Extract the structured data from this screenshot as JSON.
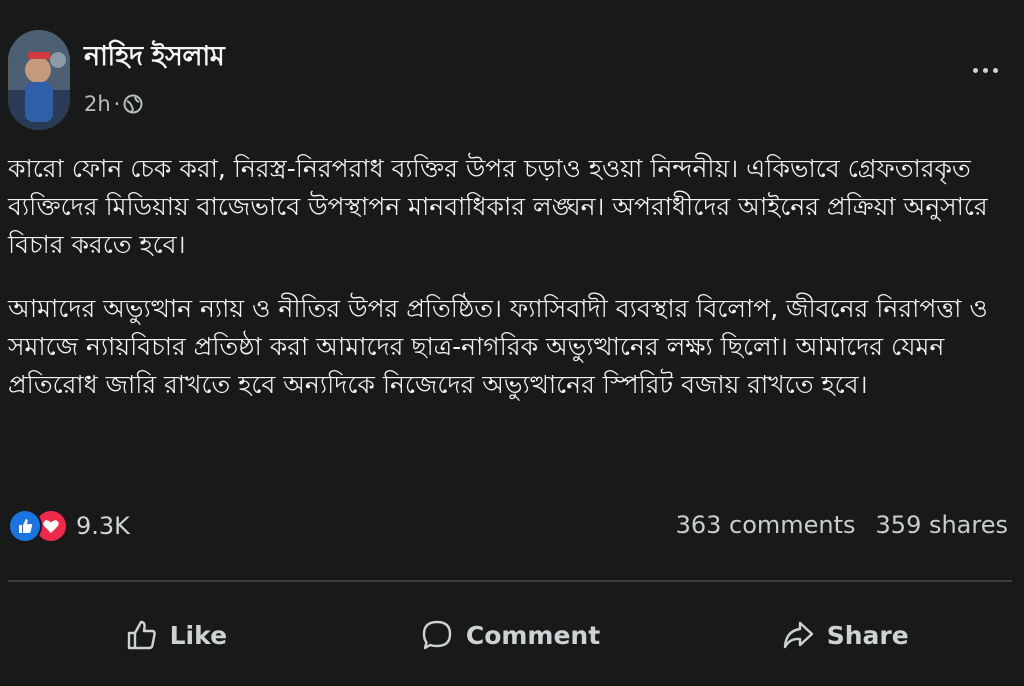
{
  "post": {
    "author": "নাহিদ ইসলাম",
    "time": "2h",
    "separator": "·",
    "privacy_icon": "globe-icon",
    "more_icon": "more-horizontal-icon",
    "paragraphs": [
      "কারো ফোন চেক করা, নিরস্ত্র-নিরপরাধ ব্যক্তির উপর চড়াও হওয়া নিন্দনীয়। একিভাবে গ্রেফতারকৃত ব্যক্তিদের মিডিয়ায় বাজেভাবে উপস্থাপন মানবাধিকার লঙ্ঘন। অপরাধীদের আইনের প্রক্রিয়া অনুসারে বিচার করতে হবে।",
      "আমাদের অভ্যুত্থান ন্যায় ও নীতির উপর প্রতিষ্ঠিত। ফ্যাসিবাদী ব্যবস্থার বিলোপ, জীবনের নিরাপত্তা ও সমাজে ন্যায়বিচার প্রতিষ্ঠা করা আমাদের ছাত্র-নাগরিক অভ্যুত্থানের লক্ষ্য ছিলো। আমাদের যেমন প্রতিরোধ জারি রাখতে হবে অন্যদিকে নিজেদের অভ্যুত্থানের স্পিরিট বজায় রাখতে হবে।"
    ]
  },
  "stats": {
    "reaction_icons": [
      "like-icon",
      "love-icon"
    ],
    "reaction_count": "9.3K",
    "comments": "363 comments",
    "shares": "359 shares"
  },
  "actions": {
    "like": "Like",
    "comment": "Comment",
    "share": "Share"
  },
  "colors": {
    "background": "#181a19",
    "like_blue": "#1b74e4",
    "love_red": "#f02849"
  }
}
